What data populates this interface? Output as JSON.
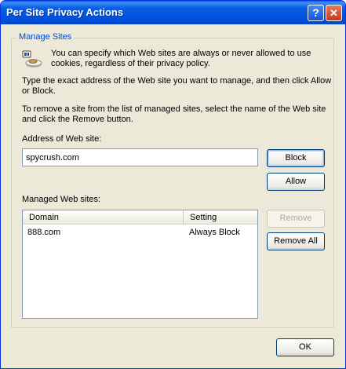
{
  "window": {
    "title": "Per Site Privacy Actions",
    "help_label": "?",
    "close_label": "✕"
  },
  "group": {
    "legend": "Manage Sites"
  },
  "info": {
    "line1": "You can specify which Web sites are always or never allowed to use",
    "line2": "cookies, regardless of their privacy policy.",
    "instr1_line1": "Type the exact address of the Web site you want to manage, and then click Allow",
    "instr1_line2": "or Block.",
    "instr2_line1": "To remove a site from the list of managed sites, select the name of the Web site",
    "instr2_line2": "and click the Remove button."
  },
  "address": {
    "label": "Address of Web site:",
    "value": "spycrush.com"
  },
  "buttons": {
    "block": "Block",
    "allow": "Allow",
    "remove": "Remove",
    "remove_all": "Remove All",
    "ok": "OK"
  },
  "managed": {
    "label": "Managed Web sites:",
    "columns": {
      "domain": "Domain",
      "setting": "Setting"
    },
    "rows": [
      {
        "domain": "888.com",
        "setting": "Always Block"
      }
    ]
  }
}
